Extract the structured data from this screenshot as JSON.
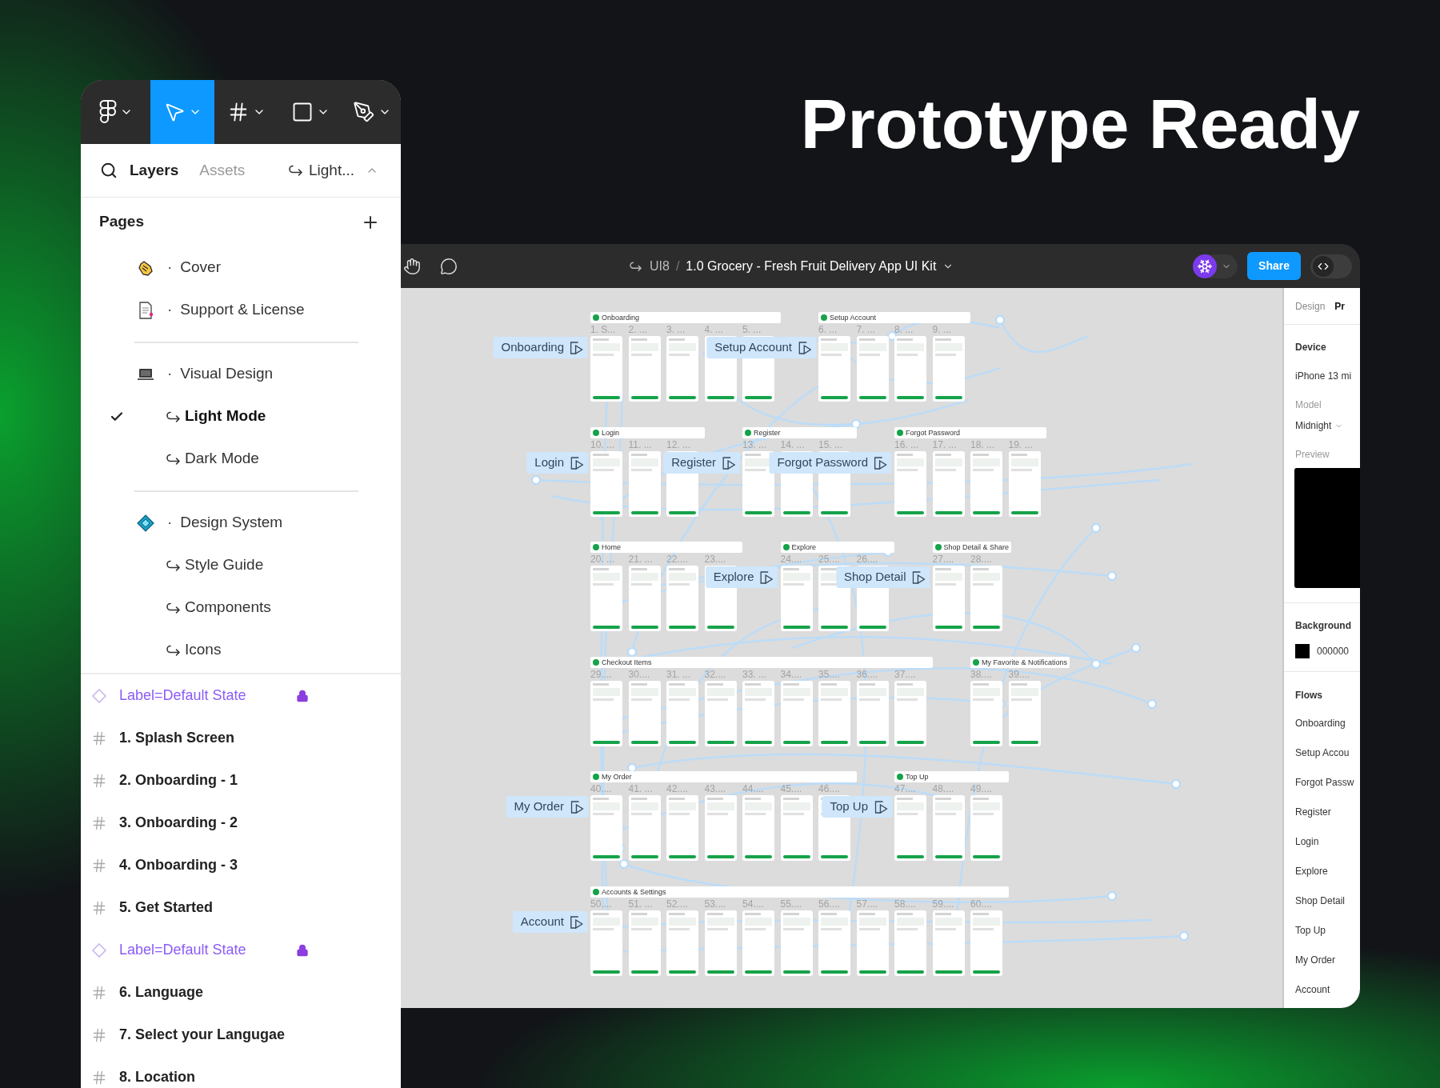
{
  "headline": "Prototype Ready",
  "layers_panel": {
    "tools": [
      {
        "selected": false
      },
      {
        "selected": true
      },
      {
        "selected": false
      },
      {
        "selected": false
      },
      {
        "selected": false
      }
    ],
    "tabs": [
      {
        "label": "Layers",
        "selected": true
      },
      {
        "label": "Assets",
        "selected": false
      }
    ],
    "page_switch": "Light...",
    "pages_title": "Pages",
    "page_groups": [
      [
        {
          "bullet": "·",
          "name": "Cover",
          "selected": false
        },
        {
          "bullet": "·",
          "name": "Support & License",
          "selected": false
        }
      ],
      [
        {
          "bullet": "·",
          "name": "Visual Design",
          "selected": false,
          "children": [
            {
              "name": "Light Mode",
              "selected": true
            },
            {
              "name": "Dark Mode",
              "selected": false
            }
          ]
        }
      ],
      [
        {
          "bullet": "·",
          "name": "Design System",
          "selected": false,
          "children": [
            {
              "name": "Style Guide",
              "selected": false
            },
            {
              "name": "Components",
              "selected": false
            },
            {
              "name": "Icons",
              "selected": false
            }
          ]
        }
      ]
    ],
    "layers": [
      {
        "kind": "component",
        "name": "Label=Default State",
        "locked": true
      },
      {
        "kind": "frame",
        "name": "1. Splash Screen",
        "locked": false
      },
      {
        "kind": "frame",
        "name": "2. Onboarding - 1",
        "locked": false
      },
      {
        "kind": "frame",
        "name": "3. Onboarding - 2",
        "locked": false
      },
      {
        "kind": "frame",
        "name": "4. Onboarding - 3",
        "locked": false
      },
      {
        "kind": "frame",
        "name": "5. Get Started",
        "locked": false
      },
      {
        "kind": "component",
        "name": "Label=Default State",
        "locked": true
      },
      {
        "kind": "frame",
        "name": "6. Language",
        "locked": false
      },
      {
        "kind": "frame",
        "name": "7. Select your Langugae",
        "locked": false
      },
      {
        "kind": "frame",
        "name": "8. Location",
        "locked": false
      }
    ]
  },
  "editor": {
    "breadcrumb": {
      "team": "UI8",
      "separator": "/",
      "file": "1.0 Grocery - Fresh Fruit Delivery App UI Kit"
    },
    "share": "Share",
    "dev_mode": {
      "on": false
    },
    "canvas": {
      "rows": [
        {
          "sections": [
            {
              "title": "Onboarding",
              "flow": "Onboarding",
              "frames": [
                "1. S...",
                "2. ...",
                "3. ...",
                "4. ...",
                "5. ..."
              ]
            },
            {
              "title": "Setup Account",
              "flow": "Setup Account",
              "frames": [
                "6. ...",
                "7. ...",
                "8. ...",
                "9. ..."
              ]
            }
          ]
        },
        {
          "sections": [
            {
              "title": "Login",
              "flow": "Login",
              "frames": [
                "10. ...",
                "11. ...",
                "12. ..."
              ]
            },
            {
              "title": "Register",
              "flow": "Register",
              "frames": [
                "13. ...",
                "14. ...",
                "15. ..."
              ]
            },
            {
              "title": "Forgot Password",
              "flow": "Forgot Password",
              "frames": [
                "16. ...",
                "17. ...",
                "18. ...",
                "19. ..."
              ]
            }
          ]
        },
        {
          "sections": [
            {
              "title": "Home",
              "frames": [
                "20. ...",
                "21. ...",
                "22....",
                "23...."
              ]
            },
            {
              "title": "Explore",
              "flow": "Explore",
              "frames": [
                "24....",
                "25....",
                "26...."
              ]
            },
            {
              "title": "Shop Detail & Share",
              "flow": "Shop Detail",
              "frames": [
                "27....",
                "28...."
              ]
            }
          ]
        },
        {
          "sections": [
            {
              "title": "Checkout Items",
              "frames": [
                "29....",
                "30....",
                "31. ...",
                "32....",
                "33. ...",
                "34....",
                "35....",
                "36....",
                "37...."
              ]
            },
            {
              "title": "My Favorite & Notifications",
              "frames": [
                "38....",
                "39...."
              ]
            }
          ]
        },
        {
          "sections": [
            {
              "title": "My Order",
              "flow": "My Order",
              "frames": [
                "40....",
                "41. ...",
                "42....",
                "43....",
                "44....",
                "45....",
                "46...."
              ]
            },
            {
              "title": "Top Up",
              "flow": "Top Up",
              "frames": [
                "47....",
                "48....",
                "49...."
              ]
            }
          ]
        },
        {
          "sections": [
            {
              "title": "Accounts & Settings",
              "flow": "Account",
              "frames": [
                "50....",
                "51. ...",
                "52....",
                "53....",
                "54....",
                "55....",
                "56....",
                "57....",
                "58....",
                "59....",
                "60...."
              ]
            }
          ]
        }
      ]
    },
    "properties": {
      "tabs": [
        {
          "label": "Design",
          "selected": false
        },
        {
          "label": "Pr",
          "selected": true
        }
      ],
      "device_title": "Device",
      "device": "iPhone 13 mi",
      "model_label": "Model",
      "model": "Midnight",
      "preview_label": "Preview",
      "background_title": "Background",
      "background_hex": "000000",
      "flows_title": "Flows",
      "flows": [
        "Onboarding",
        "Setup Accou",
        "Forgot Passw",
        "Register",
        "Login",
        "Explore",
        "Shop Detail",
        "Top Up",
        "My Order",
        "Account"
      ]
    }
  }
}
